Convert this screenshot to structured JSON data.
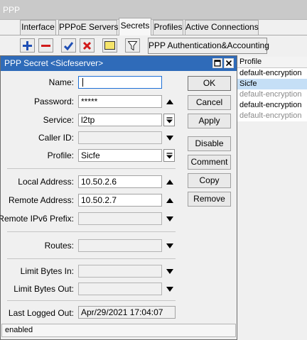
{
  "window": {
    "title": "PPP"
  },
  "tabs": [
    {
      "label": "Interface"
    },
    {
      "label": "PPPoE Servers"
    },
    {
      "label": "Secrets"
    },
    {
      "label": "Profiles"
    },
    {
      "label": "Active Connections"
    }
  ],
  "toolbar": {
    "auth_button": "PPP Authentication&Accounting"
  },
  "list": {
    "header": "Profile",
    "rows": [
      {
        "profile": "default-encryption"
      },
      {
        "profile": "Sicfe"
      },
      {
        "profile": "default-encryption"
      },
      {
        "profile": "default-encryption"
      },
      {
        "profile": "default-encryption"
      }
    ]
  },
  "dialog": {
    "title": "PPP Secret <Sicfeserver>",
    "fields": {
      "name": {
        "label": "Name:",
        "value": ""
      },
      "password": {
        "label": "Password:",
        "value": "*****"
      },
      "service": {
        "label": "Service:",
        "value": "l2tp"
      },
      "caller_id": {
        "label": "Caller ID:",
        "value": ""
      },
      "profile": {
        "label": "Profile:",
        "value": "Sicfe"
      },
      "local_address": {
        "label": "Local Address:",
        "value": "10.50.2.6"
      },
      "remote_address": {
        "label": "Remote Address:",
        "value": "10.50.2.7"
      },
      "remote_ipv6_prefix": {
        "label": "Remote IPv6 Prefix:",
        "value": ""
      },
      "routes": {
        "label": "Routes:",
        "value": ""
      },
      "limit_bytes_in": {
        "label": "Limit Bytes In:",
        "value": ""
      },
      "limit_bytes_out": {
        "label": "Limit Bytes Out:",
        "value": ""
      },
      "last_logged_out": {
        "label": "Last Logged Out:",
        "value": "Apr/29/2021 17:04:07"
      }
    },
    "buttons": {
      "ok": "OK",
      "cancel": "Cancel",
      "apply": "Apply",
      "disable": "Disable",
      "comment": "Comment",
      "copy": "Copy",
      "remove": "Remove"
    },
    "status": "enabled"
  }
}
